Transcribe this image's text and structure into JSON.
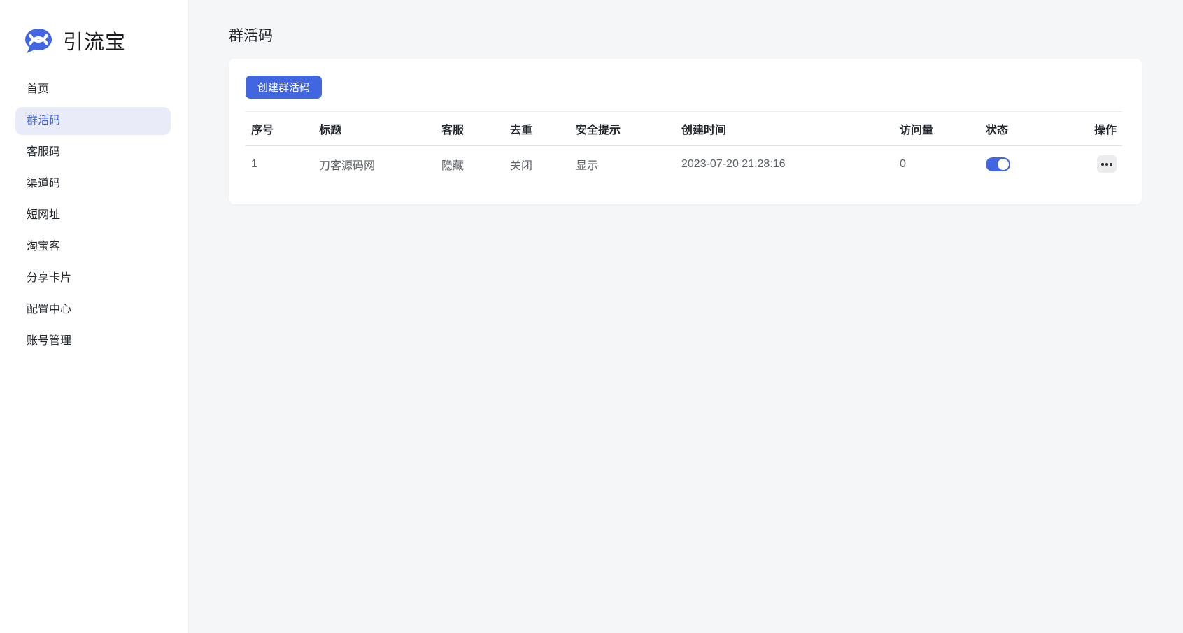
{
  "brand": {
    "name": "引流宝"
  },
  "sidebar": {
    "items": [
      {
        "label": "首页",
        "active": false
      },
      {
        "label": "群活码",
        "active": true
      },
      {
        "label": "客服码",
        "active": false
      },
      {
        "label": "渠道码",
        "active": false
      },
      {
        "label": "短网址",
        "active": false
      },
      {
        "label": "淘宝客",
        "active": false
      },
      {
        "label": "分享卡片",
        "active": false
      },
      {
        "label": "配置中心",
        "active": false
      },
      {
        "label": "账号管理",
        "active": false
      }
    ]
  },
  "page": {
    "title": "群活码"
  },
  "toolbar": {
    "create_button": "创建群活码"
  },
  "table": {
    "columns": [
      "序号",
      "标题",
      "客服",
      "去重",
      "安全提示",
      "创建时间",
      "访问量",
      "状态",
      "操作"
    ],
    "rows": [
      {
        "index": "1",
        "title": "刀客源码网",
        "service": "隐藏",
        "dedupe": "关闭",
        "safety": "显示",
        "created": "2023-07-20 21:28:16",
        "visits": "0",
        "status_on": true
      }
    ]
  },
  "icons": {
    "logo": "chat-bubble-dna-icon",
    "row_actions": "ellipsis-icon"
  },
  "colors": {
    "primary": "#4166e0",
    "primary_light": "#e9ebf8",
    "page_bg": "#f5f6f8",
    "divider": "#e8ebef",
    "header_divider": "#dfe3e8",
    "text_dark": "#23272e",
    "text_gray": "#5c6167"
  }
}
